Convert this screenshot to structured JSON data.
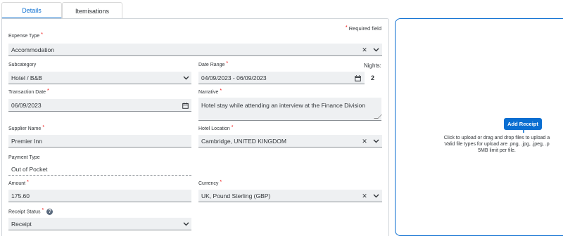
{
  "tabs": [
    {
      "label": "Details",
      "active": true
    },
    {
      "label": "Itemisations",
      "active": false
    }
  ],
  "required_note": "Required field",
  "fields": {
    "expense_type": {
      "label": "Expense Type",
      "value": "Accommodation"
    },
    "subcategory": {
      "label": "Subcategory",
      "value": "Hotel / B&B"
    },
    "date_range": {
      "label": "Date Range",
      "value": "04/09/2023 - 06/09/2023"
    },
    "nights": {
      "label": "Nights:",
      "value": "2"
    },
    "transaction_date": {
      "label": "Transaction Date",
      "value": "06/09/2023"
    },
    "narrative": {
      "label": "Narrative",
      "value": "Hotel stay while attending an interview at the Finance Division"
    },
    "supplier_name": {
      "label": "Supplier Name",
      "value": "Premier Inn"
    },
    "hotel_location": {
      "label": "Hotel Location",
      "value": "Cambridge, UNITED KINGDOM"
    },
    "payment_type": {
      "label": "Payment Type",
      "value": "Out of Pocket"
    },
    "amount": {
      "label": "Amount",
      "value": "175.60"
    },
    "currency": {
      "label": "Currency",
      "value": "UK, Pound Sterling (GBP)"
    },
    "receipt_status": {
      "label": "Receipt Status",
      "value": "Receipt"
    }
  },
  "upload": {
    "button_label": "Add Receipt",
    "line1": "Click to upload or drag and drop files to upload a",
    "line2": "Valid file types for upload are .png, .jpg, .jpeg, .p",
    "line3": "5MB limit per file."
  },
  "glyphs": {
    "required_star": "*",
    "clear": "✕",
    "help": "?"
  }
}
